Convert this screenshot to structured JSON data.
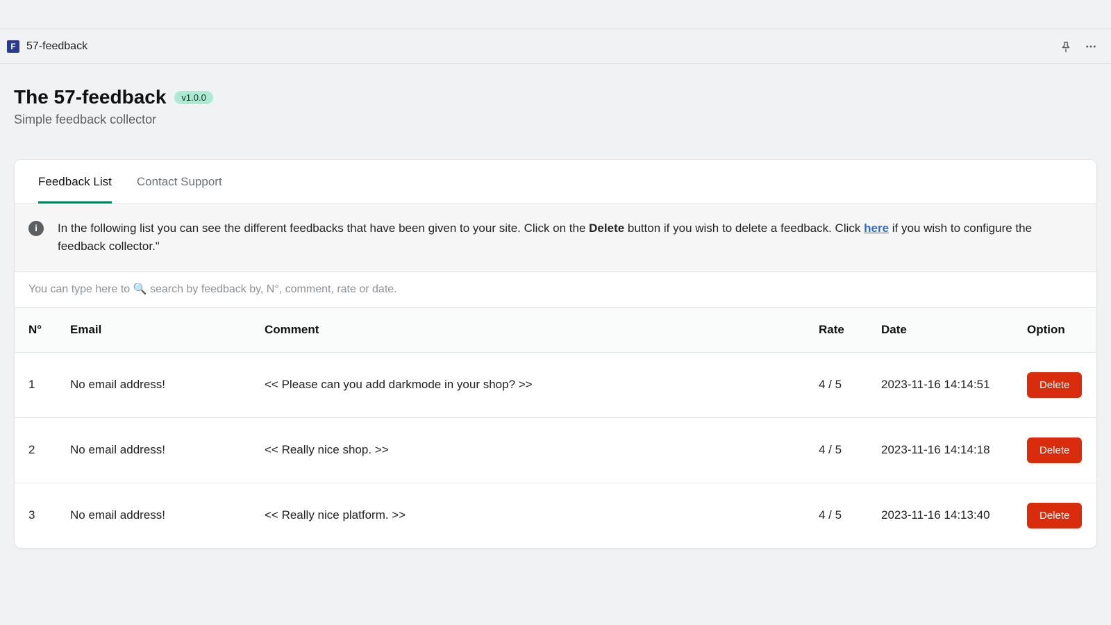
{
  "appbar": {
    "name": "57-feedback",
    "logo_letter": "F"
  },
  "header": {
    "title": "The 57-feedback",
    "version_badge": "v1.0.0",
    "subtitle": "Simple feedback collector"
  },
  "tabs": [
    {
      "label": "Feedback List",
      "active": true
    },
    {
      "label": "Contact Support",
      "active": false
    }
  ],
  "banner": {
    "text_before_bold": "In the following list you can see the different feedbacks that have been given to your site. Click on the ",
    "bold_word": "Delete",
    "text_after_bold": " button if you wish to delete a feedback. Click ",
    "link_text": "here",
    "text_after_link": " if you wish to configure the feedback collector.\""
  },
  "search": {
    "placeholder": "You can type here to 🔍 search by feedback by, N°, comment, rate or date."
  },
  "table": {
    "columns": {
      "n": "N°",
      "email": "Email",
      "comment": "Comment",
      "rate": "Rate",
      "date": "Date",
      "option": "Option"
    },
    "delete_label": "Delete",
    "rows": [
      {
        "n": "1",
        "email": "No email address!",
        "comment": "<< Please can you add darkmode in your shop? >>",
        "rate": "4 / 5",
        "date": "2023-11-16 14:14:51"
      },
      {
        "n": "2",
        "email": "No email address!",
        "comment": "<< Really nice shop. >>",
        "rate": "4 / 5",
        "date": "2023-11-16 14:14:18"
      },
      {
        "n": "3",
        "email": "No email address!",
        "comment": "<< Really nice platform. >>",
        "rate": "4 / 5",
        "date": "2023-11-16 14:13:40"
      }
    ]
  }
}
